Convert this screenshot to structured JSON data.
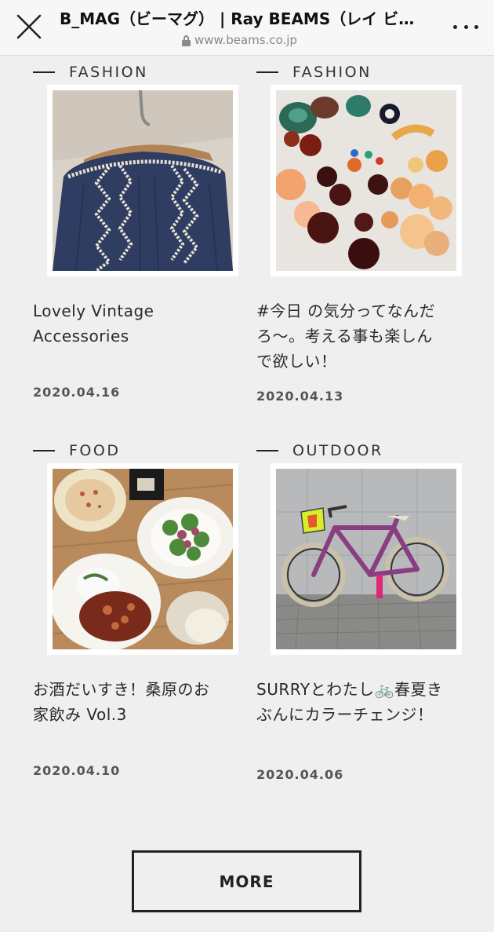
{
  "header": {
    "title": "B_MAG（ビーマグ） | Ray BEAMS（レイ ビ…",
    "url": "www.beams.co.jp",
    "close_icon": "close-icon",
    "menu_icon": "more-options-icon"
  },
  "articles": [
    {
      "category": "FASHION",
      "title": "Lovely Vintage Accessories",
      "date": "2020.04.16",
      "image": "vintage-embroidered-blouse"
    },
    {
      "category": "FASHION",
      "title": "#今日 の気分ってなんだろ〜。考える事も楽しんで欲しい！",
      "date": "2020.04.13",
      "image": "beaded-earrings"
    },
    {
      "category": "FOOD",
      "title": "お酒だいすき！桑原のお家飲み Vol.3",
      "date": "2020.04.10",
      "image": "home-dinner-plates"
    },
    {
      "category": "OUTDOOR",
      "title": "SURRYとわたし🚲春夏きぶんにカラーチェンジ！",
      "date": "2020.04.06",
      "image": "purple-bicycle"
    }
  ],
  "more_button": {
    "label": "MORE"
  }
}
